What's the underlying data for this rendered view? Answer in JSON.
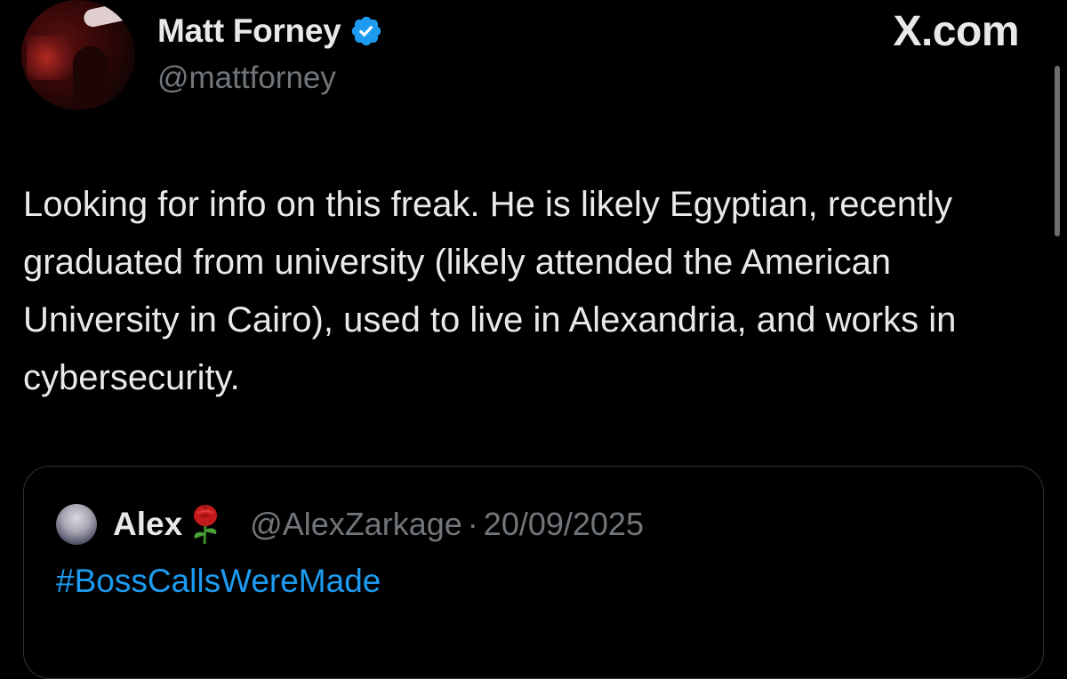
{
  "author": {
    "display_name": "Matt Forney",
    "handle": "@mattforney",
    "verified": true,
    "verified_color": "#1d9bf0"
  },
  "brand": {
    "label": "X.com"
  },
  "tweet": {
    "text": "Looking for info on this freak. He is likely Egyptian, recently graduated from university (likely attended the American University in Cairo), used to live in Alexandria, and works in cybersecurity."
  },
  "quoted_tweet": {
    "display_name": "Alex",
    "emoji_icon": "rose-icon",
    "handle": "@AlexZarkage",
    "separator": "·",
    "date": "20/09/2025",
    "hashtag": "#BossCallsWereMade",
    "hashtag_color": "#1d9bf0"
  },
  "theme": {
    "background": "#000000",
    "text_primary": "#e7e9ea",
    "text_secondary": "#71767b"
  }
}
